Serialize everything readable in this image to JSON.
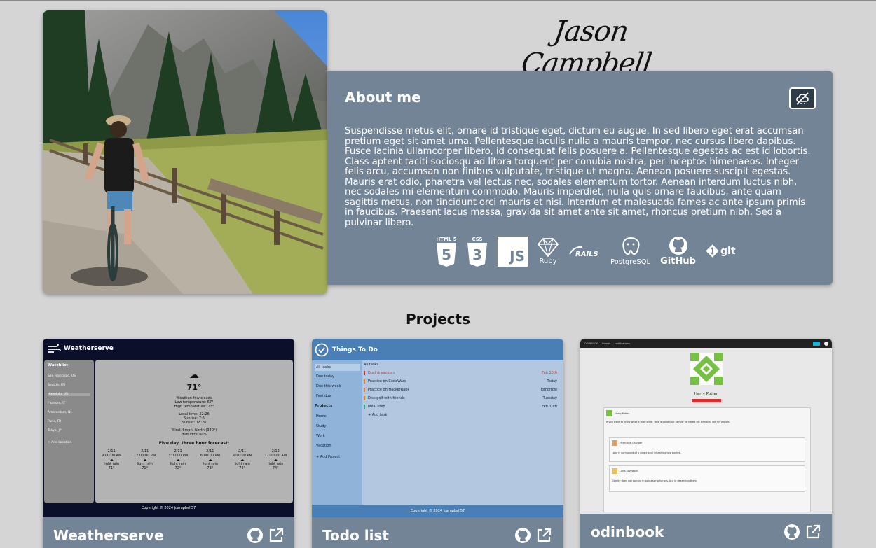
{
  "profile": {
    "name": "Jason Campbell"
  },
  "about": {
    "heading": "About me",
    "body": "Suspendisse metus elit, ornare id tristique eget, dictum eu augue. In sed libero eget erat accumsan pretium eget sit amet urna. Pellentesque iaculis nulla a mauris tempor, nec cursus libero dapibus. Fusce lacinia ullamcorper libero, id consequat felis posuere a. Pellentesque egestas ac est id lobortis. Class aptent taciti sociosqu ad litora torquent per conubia nostra, per inceptos himenaeos. Integer felis arcu, accumsan non finibus vulputate, tristique ut magna. Aenean posuere suscipit egestas. Mauris erat odio, pharetra vel lectus nec, sodales elementum tortor. Aenean interdum luctus nibh, nec sodales mi elementum commodo. Mauris imperdiet, nulla quis ornare faucibus, ante quam sagittis metus, non tincidunt orci mauris et nisi. Interdum et malesuada fames ac ante ipsum primis in faucibus. Praesent lacus massa, gravida sit amet ante sit amet, rhoncus pretium nibh. Sed a pulvinar libero.",
    "tech": [
      {
        "icon": "html5-icon",
        "label": "HTML 5"
      },
      {
        "icon": "css3-icon",
        "label": "CSS 3"
      },
      {
        "icon": "javascript-icon",
        "label": "JS"
      },
      {
        "icon": "ruby-icon",
        "label": "Ruby"
      },
      {
        "icon": "rails-icon",
        "label": "RAILS"
      },
      {
        "icon": "postgresql-icon",
        "label": "PostgreSQL"
      },
      {
        "icon": "github-icon",
        "label": "GitHub"
      },
      {
        "icon": "git-icon",
        "label": "git"
      }
    ]
  },
  "projects": {
    "heading": "Projects",
    "items": [
      {
        "title": "Weatherserve"
      },
      {
        "title": "Todo list"
      },
      {
        "title": "odinbook"
      }
    ]
  },
  "weatherserve": {
    "app_name": "Weatherserve",
    "watchlist_heading": "Watchlist",
    "locations": [
      "San Francisco, US",
      "Seattle, US",
      "Honolulu, US",
      "Flumore, IT",
      "Amsterdam, NL",
      "Paris, FR",
      "Tokyo, JP"
    ],
    "add_location": "+ Add Location",
    "temp": "71°",
    "details": [
      "Weather: few clouds",
      "Low temperature: 67°",
      "High temperature: 73°",
      "",
      "Local time: 22:26",
      "Sunrise: 7:5",
      "Sunset: 18:26",
      "",
      "Wind: 6mph, North (340°)",
      "Humidity: 60%"
    ],
    "forecast_heading": "Five day, three hour forecast:",
    "forecast": [
      {
        "date": "2/11",
        "time": "9:00:00 AM",
        "desc": "light rain",
        "temp": "71°"
      },
      {
        "date": "2/11",
        "time": "12:00:00 PM",
        "desc": "light rain",
        "temp": "71°"
      },
      {
        "date": "2/11",
        "time": "3:00:00 PM",
        "desc": "light rain",
        "temp": "72°"
      },
      {
        "date": "2/11",
        "time": "6:00:00 PM",
        "desc": "light rain",
        "temp": "73°"
      },
      {
        "date": "2/11",
        "time": "9:00:00 PM",
        "desc": "light rain",
        "temp": "74°"
      },
      {
        "date": "2/12",
        "time": "12:00:00 AM",
        "desc": "light rain",
        "temp": "74°"
      }
    ],
    "footer": "Copyright © 2024 jcampbell57"
  },
  "todo": {
    "app_name": "Things To Do",
    "nav": [
      "All tasks",
      "Due today",
      "Due this week",
      "Past due"
    ],
    "projects_heading": "Projects",
    "projects": [
      "Home",
      "Study",
      "Work",
      "Vacation"
    ],
    "add_project": "+ Add Project",
    "list_heading": "All tasks",
    "tasks": [
      {
        "name": "Dust & vacuum",
        "due": "Feb 10th",
        "color": "#c0392b"
      },
      {
        "name": "Practice on CodeWars",
        "due": "Today",
        "color": "#e67e22"
      },
      {
        "name": "Practice on HackerRank",
        "due": "Tomorrow",
        "color": "#e67e22"
      },
      {
        "name": "Disc golf with friends",
        "due": "Tuesday",
        "color": "#e67e22"
      },
      {
        "name": "Meal Prep",
        "due": "Feb 10th",
        "color": "#27ae60"
      }
    ],
    "add_task": "+ Add task",
    "footer": "Copyright © 2024 jcampbell57"
  },
  "odinbook": {
    "nav": [
      "ODINBOOK",
      "friends",
      "notifications"
    ],
    "profile_name": "Harry Potter",
    "post_author": "Harry Potter",
    "post_text": "If you want to know what a man's like, take a good look at how he treats his inferiors, not his equals.",
    "comments": [
      {
        "author": "Hermione Granger",
        "text": "Love is composed of a single soul inhabiting two bodies."
      },
      {
        "author": "Luna Lovegood",
        "text": "Dignity does not consist in possessing honors, but in deserving them."
      }
    ]
  },
  "colors": {
    "background": "#d5d5d5",
    "card": "#738496",
    "weather_header": "#0b0f2a",
    "todo_header": "#4a7fb5"
  }
}
